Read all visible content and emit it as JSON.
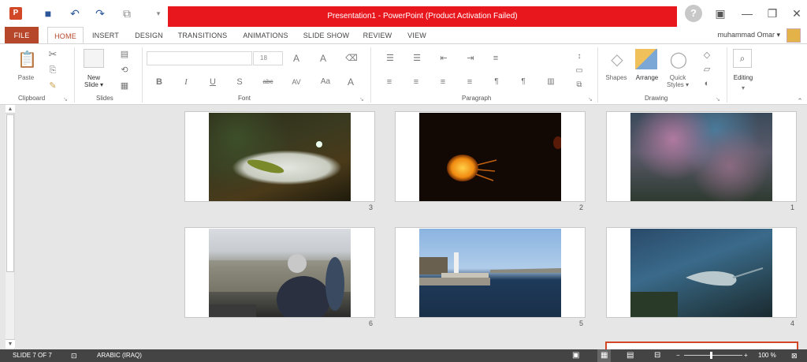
{
  "window": {
    "title": "Presentation1 - PowerPoint (Product Activation Failed)",
    "help": "?",
    "minimize": "—",
    "restore": "❐",
    "close": "✕",
    "options": "▣"
  },
  "user": {
    "name": "muhammad Omar ▾"
  },
  "tabs": {
    "file": "FILE",
    "home": "HOME",
    "insert": "INSERT",
    "design": "DESIGN",
    "transitions": "TRANSITIONS",
    "animations": "ANIMATIONS",
    "slideshow": "SLIDE SHOW",
    "review": "REVIEW",
    "view": "VIEW"
  },
  "ribbon": {
    "clipboard": {
      "label": "Clipboard",
      "paste": "Paste"
    },
    "slides": {
      "label": "Slides",
      "new_slide": "New",
      "new_slide_2": "Slide ▾"
    },
    "font": {
      "label": "Font",
      "size": "18"
    },
    "paragraph": {
      "label": "Paragraph"
    },
    "drawing": {
      "label": "Drawing",
      "shapes": "Shapes",
      "arrange": "Arrange",
      "quick_styles": "Quick",
      "quick_styles_2": "Styles ▾"
    },
    "editing": {
      "label": "Editing"
    }
  },
  "slides": [
    {
      "num": "3",
      "desc": "stingray"
    },
    {
      "num": "2",
      "desc": "jellyfish"
    },
    {
      "num": "1",
      "desc": "reef"
    },
    {
      "num": "6",
      "desc": "city"
    },
    {
      "num": "5",
      "desc": "lighthouse"
    },
    {
      "num": "4",
      "desc": "ray"
    }
  ],
  "status": {
    "slide": "SLIDE 7 OF 7",
    "language": "ARABIC (IRAQ)",
    "zoom": "100 %"
  },
  "colors": {
    "accent": "#b7472a",
    "title_band": "#e8171e",
    "status_bg": "#444444"
  }
}
